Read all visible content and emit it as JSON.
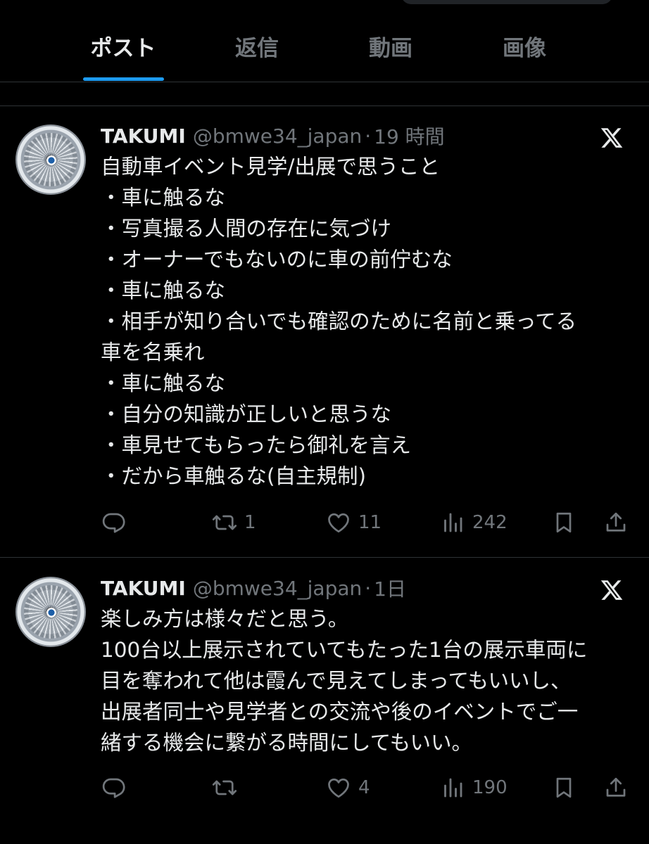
{
  "tabs": [
    {
      "label": "ポスト",
      "active": true
    },
    {
      "label": "返信",
      "active": false
    },
    {
      "label": "動画",
      "active": false
    },
    {
      "label": "画像",
      "active": false
    }
  ],
  "posts": [
    {
      "name": "TAKUMI",
      "handle": "@bmwe34_japan",
      "separator": "·",
      "time": "19 時間",
      "lines": [
        "自動車イベント見学/出展で思うこと",
        "・車に触るな",
        "・写真撮る人間の存在に気づけ",
        "・オーナーでもないのに車の前佇むな",
        "・車に触るな",
        "・相手が知り合いでも確認のために名前と乗ってる",
        "車を名乗れ",
        "・車に触るな",
        "・自分の知識が正しいと思うな",
        "・車見せてもらったら御礼を言え",
        "・だから車触るな(自主規制)"
      ],
      "reposts": "1",
      "likes": "11",
      "views": "242"
    },
    {
      "name": "TAKUMI",
      "handle": "@bmwe34_japan",
      "separator": "·",
      "time": "1日",
      "lines": [
        "楽しみ方は様々だと思う。",
        "100台以上展示されていてもたった1台の展示車両に",
        "目を奪われて他は霞んで見えてしまってもいいし、",
        "出展者同士や見学者との交流や後のイベントでご一",
        "緒する機会に繋がる時間にしてもいい。"
      ],
      "reposts": "",
      "likes": "4",
      "views": "190"
    }
  ],
  "icons": {
    "reply": "reply-icon",
    "repost": "repost-icon",
    "like": "heart-icon",
    "views": "views-icon",
    "bookmark": "bookmark-icon",
    "share": "share-icon",
    "x": "x-logo-icon"
  },
  "colors": {
    "background": "#000000",
    "text": "#e7e9ea",
    "muted": "#71767b",
    "accent": "#1d9bf0",
    "divider": "#2f3336"
  }
}
